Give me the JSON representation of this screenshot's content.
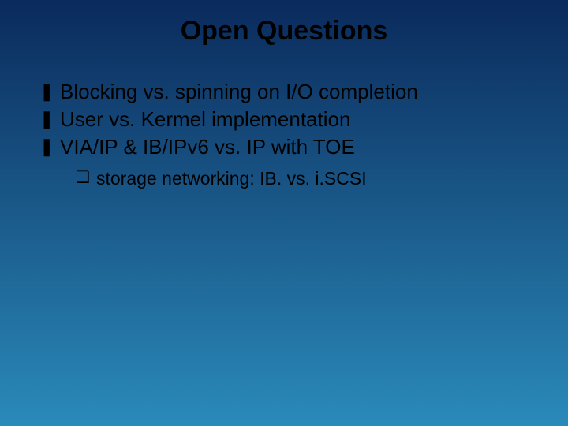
{
  "title": "Open Questions",
  "bullets": [
    {
      "glyph": "❚",
      "text": "Blocking vs. spinning on I/O completion"
    },
    {
      "glyph": "❚",
      "text": "User vs. Kermel implementation"
    },
    {
      "glyph": "❚",
      "text": "VIA/IP & IB/IPv6 vs. IP with TOE"
    }
  ],
  "subbullets": [
    {
      "glyph": "❑",
      "text": "storage networking: IB. vs. i.SCSI"
    }
  ]
}
